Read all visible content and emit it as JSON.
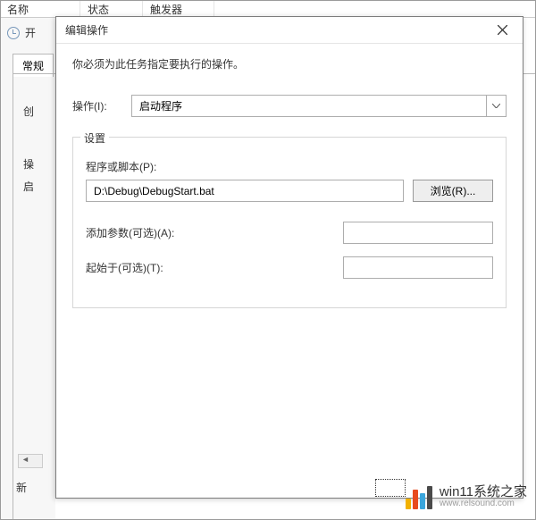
{
  "bg": {
    "header": {
      "name": "名称",
      "status": "状态",
      "trigger": "触发器"
    },
    "open_label": "开",
    "tabs": {
      "general": "常规"
    },
    "create_label": "创",
    "col_action": "操",
    "col_arg": "启",
    "new_label": "新"
  },
  "dialog": {
    "title": "编辑操作",
    "instruction": "你必须为此任务指定要执行的操作。",
    "action_label": "操作(I):",
    "action_value": "启动程序",
    "settings_legend": "设置",
    "script_label": "程序或脚本(P):",
    "script_value": "D:\\Debug\\DebugStart.bat",
    "browse_label": "浏览(R)...",
    "args_label": "添加参数(可选)(A):",
    "args_value": "",
    "startin_label": "起始于(可选)(T):",
    "startin_value": ""
  },
  "watermark": {
    "cn": "win11系统之家",
    "url": "www.relsound.com"
  }
}
